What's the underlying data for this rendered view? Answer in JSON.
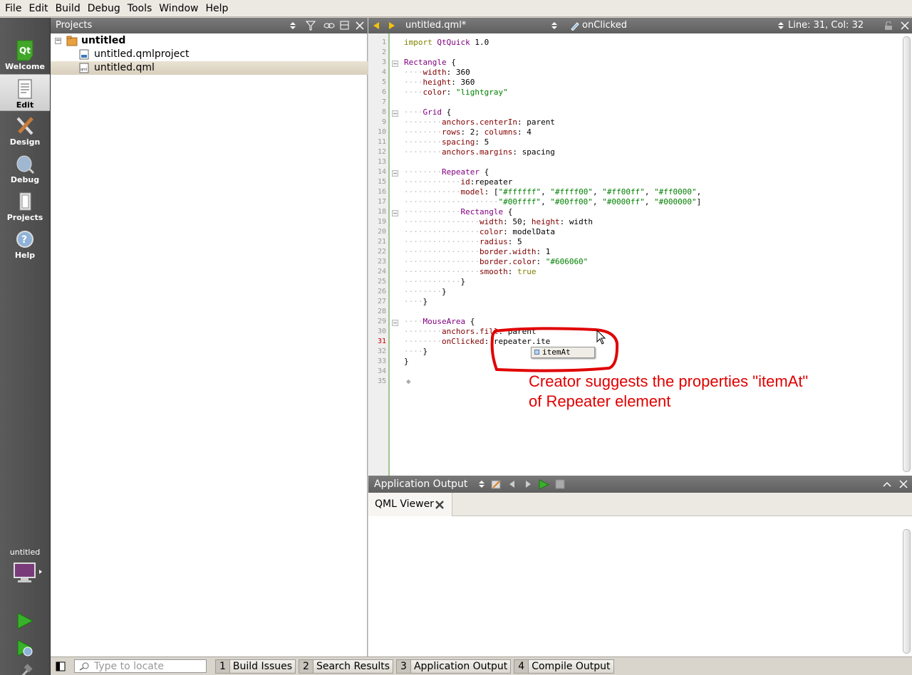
{
  "menu": [
    "File",
    "Edit",
    "Build",
    "Debug",
    "Tools",
    "Window",
    "Help"
  ],
  "modes": [
    {
      "label": "Welcome",
      "icon": "qt-logo-icon"
    },
    {
      "label": "Edit",
      "icon": "edit-document-icon"
    },
    {
      "label": "Design",
      "icon": "design-brush-icon"
    },
    {
      "label": "Debug",
      "icon": "debug-bug-icon"
    },
    {
      "label": "Projects",
      "icon": "projects-icon"
    },
    {
      "label": "Help",
      "icon": "help-icon"
    }
  ],
  "target": {
    "label": "untitled"
  },
  "projects": {
    "title": "Projects",
    "tree": [
      {
        "label": "untitled",
        "level": 0,
        "bold": true
      },
      {
        "label": "untitled.qmlproject",
        "level": 1
      },
      {
        "label": "untitled.qml",
        "level": 1,
        "selected": true
      }
    ]
  },
  "editor": {
    "file": "untitled.qml*",
    "symbol": "onClicked",
    "position": "Line: 31, Col: 32",
    "completion": "itemAt"
  },
  "annotation": {
    "line1": "Creator suggests the properties \"itemAt\"",
    "line2": "of Repeater element",
    "color": "#e00000"
  },
  "output": {
    "title": "Application Output",
    "tab": "QML Viewer"
  },
  "status": {
    "locate_placeholder": "Type to locate",
    "buttons": [
      {
        "num": "1",
        "label": "Build Issues"
      },
      {
        "num": "2",
        "label": "Search Results"
      },
      {
        "num": "3",
        "label": "Application Output"
      },
      {
        "num": "4",
        "label": "Compile Output"
      }
    ]
  }
}
